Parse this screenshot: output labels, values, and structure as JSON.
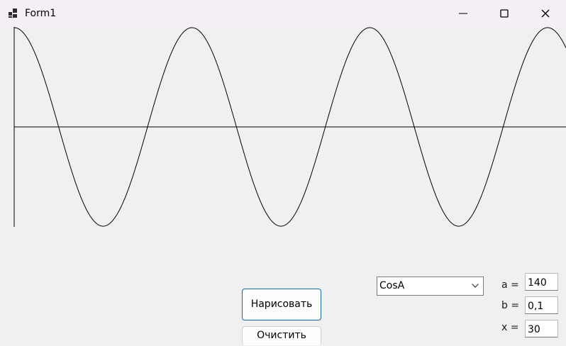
{
  "window": {
    "title": "Form1",
    "controls": {
      "minimize": "minimize-icon",
      "maximize": "maximize-icon",
      "close": "close-icon"
    }
  },
  "chart_data": {
    "type": "line",
    "function": "CosA",
    "x": [
      0,
      1,
      2,
      3,
      4,
      5,
      6,
      7,
      8,
      9,
      10,
      11,
      12,
      13,
      14,
      15,
      16,
      17,
      18,
      19
    ],
    "y": [
      1.0,
      0.54,
      -0.416,
      -0.99,
      -0.654,
      0.284,
      0.96,
      0.754,
      -0.146,
      -0.911,
      -0.839,
      0.004,
      0.844,
      0.907,
      0.137,
      -0.76,
      -0.958,
      -0.275,
      0.66,
      0.989
    ],
    "xlim": [
      0,
      19.5
    ],
    "ylim": [
      -1,
      1
    ],
    "grid": false
  },
  "controls": {
    "draw_label": "Нарисовать",
    "clear_label": "Очистить",
    "function_selected": "CosA",
    "param_a_label": "a =",
    "param_a_value": "140",
    "param_b_label": "b =",
    "param_b_value": "0,1",
    "param_x_label": "x =",
    "param_x_value": "30"
  },
  "colors": {
    "titlebar": "#f5eef6",
    "background": "#f0f0f0",
    "curve": "#000000",
    "button_focus_border": "#1468b8"
  }
}
